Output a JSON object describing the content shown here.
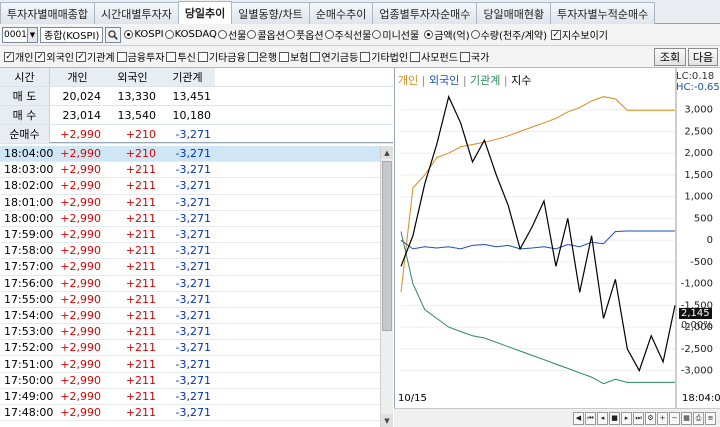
{
  "tabs": [
    {
      "label": "투자자별매매종합",
      "active": false
    },
    {
      "label": "시간대별투자자",
      "active": false
    },
    {
      "label": "당일추이",
      "active": true
    },
    {
      "label": "일별동향/차트",
      "active": false
    },
    {
      "label": "순매수추이",
      "active": false
    },
    {
      "label": "업종별투자자순매수",
      "active": false
    },
    {
      "label": "당일매매현황",
      "active": false
    },
    {
      "label": "투자자별누적순매수",
      "active": false
    }
  ],
  "toolbar": {
    "code": "0001",
    "market_name": "종합(KOSPI)",
    "market_radios": [
      {
        "label": "KOSPI",
        "selected": true
      },
      {
        "label": "KOSDAQ",
        "selected": false
      },
      {
        "label": "선물",
        "selected": false
      },
      {
        "label": "콜옵션",
        "selected": false
      },
      {
        "label": "풋옵션",
        "selected": false
      },
      {
        "label": "주식선물",
        "selected": false
      },
      {
        "label": "미니선물",
        "selected": false
      }
    ],
    "unit_radios": [
      {
        "label": "금액(억)",
        "selected": true
      },
      {
        "label": "수량(천주/계약)",
        "selected": false
      }
    ],
    "index_check": {
      "label": "지수보이기",
      "checked": true
    }
  },
  "investor_filters": [
    {
      "label": "개인",
      "checked": true
    },
    {
      "label": "외국인",
      "checked": true
    },
    {
      "label": "기관계",
      "checked": true
    },
    {
      "label": "금융투자",
      "checked": false
    },
    {
      "label": "투신",
      "checked": false
    },
    {
      "label": "기타금융",
      "checked": false
    },
    {
      "label": "은행",
      "checked": false
    },
    {
      "label": "보험",
      "checked": false
    },
    {
      "label": "연기금등",
      "checked": false
    },
    {
      "label": "기타법인",
      "checked": false
    },
    {
      "label": "사모펀드",
      "checked": false
    },
    {
      "label": "국가",
      "checked": false
    }
  ],
  "buttons": {
    "query": "조회",
    "next": "다음"
  },
  "summary": {
    "headers": [
      "시간",
      "개인",
      "외국인",
      "기관계"
    ],
    "rows": [
      {
        "label": "매 도",
        "values": [
          "20,024",
          "13,330",
          "13,451"
        ],
        "color": "black"
      },
      {
        "label": "매 수",
        "values": [
          "23,014",
          "13,540",
          "10,180"
        ],
        "color": "black"
      },
      {
        "label": "순매수",
        "values": [
          "+2,990",
          "+210",
          "-3,271"
        ],
        "color": "mixed"
      }
    ]
  },
  "time_rows": [
    {
      "time": "18:04:00",
      "ind": "+2,990",
      "frn": "+210",
      "inst": "-3,271"
    },
    {
      "time": "18:03:00",
      "ind": "+2,990",
      "frn": "+211",
      "inst": "-3,271"
    },
    {
      "time": "18:02:00",
      "ind": "+2,990",
      "frn": "+211",
      "inst": "-3,271"
    },
    {
      "time": "18:01:00",
      "ind": "+2,990",
      "frn": "+211",
      "inst": "-3,271"
    },
    {
      "time": "18:00:00",
      "ind": "+2,990",
      "frn": "+211",
      "inst": "-3,271"
    },
    {
      "time": "17:59:00",
      "ind": "+2,990",
      "frn": "+211",
      "inst": "-3,271"
    },
    {
      "time": "17:58:00",
      "ind": "+2,990",
      "frn": "+211",
      "inst": "-3,271"
    },
    {
      "time": "17:57:00",
      "ind": "+2,990",
      "frn": "+211",
      "inst": "-3,271"
    },
    {
      "time": "17:56:00",
      "ind": "+2,990",
      "frn": "+211",
      "inst": "-3,271"
    },
    {
      "time": "17:55:00",
      "ind": "+2,990",
      "frn": "+211",
      "inst": "-3,271"
    },
    {
      "time": "17:54:00",
      "ind": "+2,990",
      "frn": "+211",
      "inst": "-3,271"
    },
    {
      "time": "17:53:00",
      "ind": "+2,990",
      "frn": "+211",
      "inst": "-3,271"
    },
    {
      "time": "17:52:00",
      "ind": "+2,990",
      "frn": "+211",
      "inst": "-3,271"
    },
    {
      "time": "17:51:00",
      "ind": "+2,990",
      "frn": "+211",
      "inst": "-3,271"
    },
    {
      "time": "17:50:00",
      "ind": "+2,990",
      "frn": "+211",
      "inst": "-3,271"
    },
    {
      "time": "17:49:00",
      "ind": "+2,990",
      "frn": "+211",
      "inst": "-3,271"
    },
    {
      "time": "17:48:00",
      "ind": "+2,990",
      "frn": "+211",
      "inst": "-3,271"
    }
  ],
  "chart": {
    "legend": [
      {
        "label": "개인",
        "color": "#d88a1e"
      },
      {
        "label": "외국인",
        "color": "#1f4fb0"
      },
      {
        "label": "기관계",
        "color": "#2a8a5a"
      },
      {
        "label": "지수",
        "color": "#000000"
      }
    ],
    "lc_label": "LC:0.18",
    "hc_label": "HC:-0.65",
    "current_value": "2,145",
    "current_pct": "0.00%",
    "date_left": "10/15",
    "time_right": "18:04:0"
  },
  "chart_data": {
    "type": "line",
    "ylim": [
      -3400,
      3500
    ],
    "yticks": [
      "3,000",
      "2,500",
      "2,000",
      "1,500",
      "1,000",
      "500",
      "0",
      "-500",
      "-1,000",
      "-1,500",
      "-2,000",
      "-2,500",
      "-3,000"
    ],
    "series": [
      {
        "name": "개인",
        "values": [
          -1200,
          1200,
          1500,
          1900,
          2000,
          2150,
          2200,
          2250,
          2320,
          2400,
          2500,
          2600,
          2700,
          2800,
          2950,
          3050,
          3200,
          3300,
          3250,
          2990,
          2990,
          2990,
          2990,
          2990
        ]
      },
      {
        "name": "외국인",
        "values": [
          0,
          -200,
          -150,
          -180,
          -150,
          -200,
          -120,
          -100,
          -150,
          -120,
          -200,
          -180,
          -150,
          -200,
          -100,
          -150,
          -50,
          -80,
          200,
          210,
          210,
          211,
          211,
          210
        ]
      },
      {
        "name": "기관계",
        "values": [
          200,
          -1000,
          -1600,
          -1800,
          -2000,
          -2100,
          -2200,
          -2250,
          -2350,
          -2450,
          -2550,
          -2650,
          -2750,
          -2850,
          -2950,
          -3050,
          -3150,
          -3300,
          -3200,
          -3271,
          -3271,
          -3271,
          -3271,
          -3271
        ]
      },
      {
        "name": "지수",
        "values": [
          -600,
          100,
          1300,
          2200,
          3300,
          2700,
          1800,
          2300,
          1500,
          800,
          -200,
          300,
          900,
          -600,
          500,
          -1200,
          100,
          -1800,
          -900,
          -2500,
          -3000,
          -2200,
          -2800,
          -1500
        ]
      }
    ]
  }
}
